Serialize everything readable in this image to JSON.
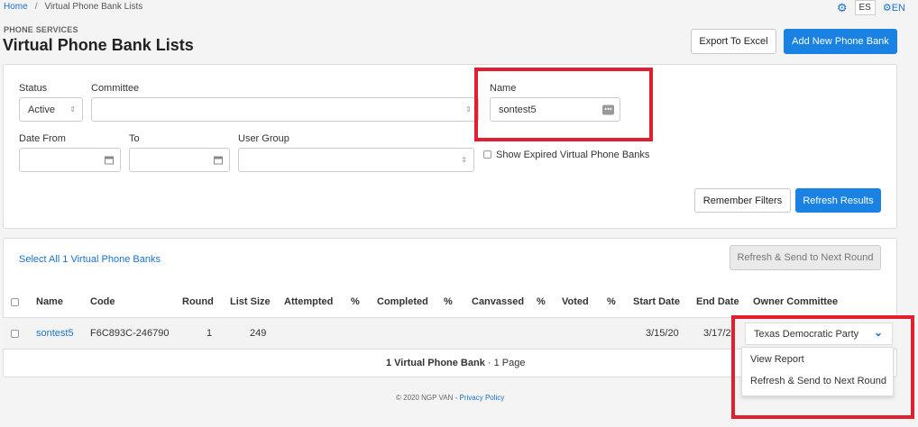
{
  "breadcrumb": {
    "home": "Home",
    "separator": "/",
    "current": "Virtual Phone Bank Lists"
  },
  "header": {
    "lang_es": "ES",
    "lang_en": "EN",
    "eyebrow": "PHONE SERVICES",
    "title": "Virtual Phone Bank Lists",
    "export_button": "Export To Excel",
    "add_button": "Add New Phone Bank"
  },
  "filters": {
    "status_label": "Status",
    "status_value": "Active",
    "committee_label": "Committee",
    "committee_value": "",
    "name_label": "Name",
    "name_value": "sontest5",
    "date_from_label": "Date From",
    "date_from_value": "",
    "to_label": "To",
    "to_value": "",
    "user_group_label": "User Group",
    "user_group_value": "",
    "show_expired_label": "Show Expired Virtual Phone Banks",
    "remember_button": "Remember Filters",
    "refresh_button": "Refresh Results"
  },
  "results": {
    "select_all": "Select All 1 Virtual Phone Banks",
    "refresh_send_button": "Refresh & Send to Next Round",
    "columns": [
      "Name",
      "Code",
      "Round",
      "List Size",
      "Attempted",
      "%",
      "Completed",
      "%",
      "Canvassed",
      "%",
      "Voted",
      "%",
      "Start Date",
      "End Date",
      "Owner Committee"
    ],
    "rows": [
      {
        "name": "sontest5",
        "code": "F6C893C-246790",
        "round": "1",
        "list_size": "249",
        "attempted": "",
        "completed": "",
        "canvassed": "",
        "voted": "",
        "start_date": "3/15/20",
        "end_date": "3/17/2",
        "owner_committee": "Texas Democratic Party"
      }
    ],
    "pagination_count": "1 Virtual Phone Bank",
    "pagination_sep": " · ",
    "pagination_pages": "1 Page"
  },
  "row_menu": {
    "items": [
      "View Report",
      "Refresh & Send to Next Round"
    ]
  },
  "footer": {
    "copyright": "© 2020 NGP VAN",
    "separator": " - ",
    "privacy": "Privacy Policy"
  },
  "colors": {
    "primary": "#1a82e2",
    "link": "#1a73c8",
    "highlight": "#e0202e"
  },
  "icons": [
    "gear-icon",
    "globe-icon",
    "calendar-icon",
    "chevron-down-icon",
    "ellipsis-icon",
    "sort-caret-icon"
  ]
}
